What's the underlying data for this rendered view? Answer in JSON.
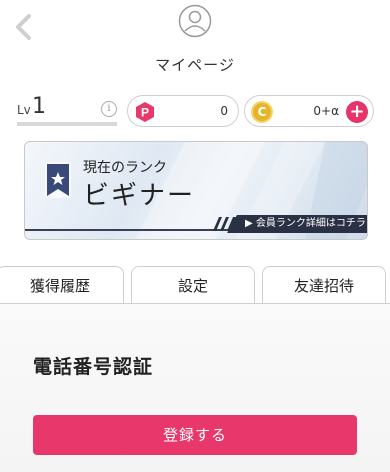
{
  "header": {
    "title": "マイページ"
  },
  "level": {
    "prefix": "Lv",
    "value": "1",
    "progress_fraction": 0
  },
  "points": {
    "p_badge": "P",
    "p_value": "0",
    "c_badge": "C",
    "c_value": "0+α",
    "plus_symbol": "+"
  },
  "rank": {
    "subtitle": "現在のランク",
    "name": "ビギナー",
    "link_label": "▶ 会員ランク詳細はコチラ"
  },
  "tabs": [
    {
      "label": "獲得履歴"
    },
    {
      "label": "設定"
    },
    {
      "label": "友達招待"
    }
  ],
  "main": {
    "section_title": "電話番号認証",
    "register_label": "登録する"
  },
  "colors": {
    "accent_pink": "#e8386b",
    "coin_gold": "#e7b52a",
    "rank_dark": "#2b3145"
  }
}
